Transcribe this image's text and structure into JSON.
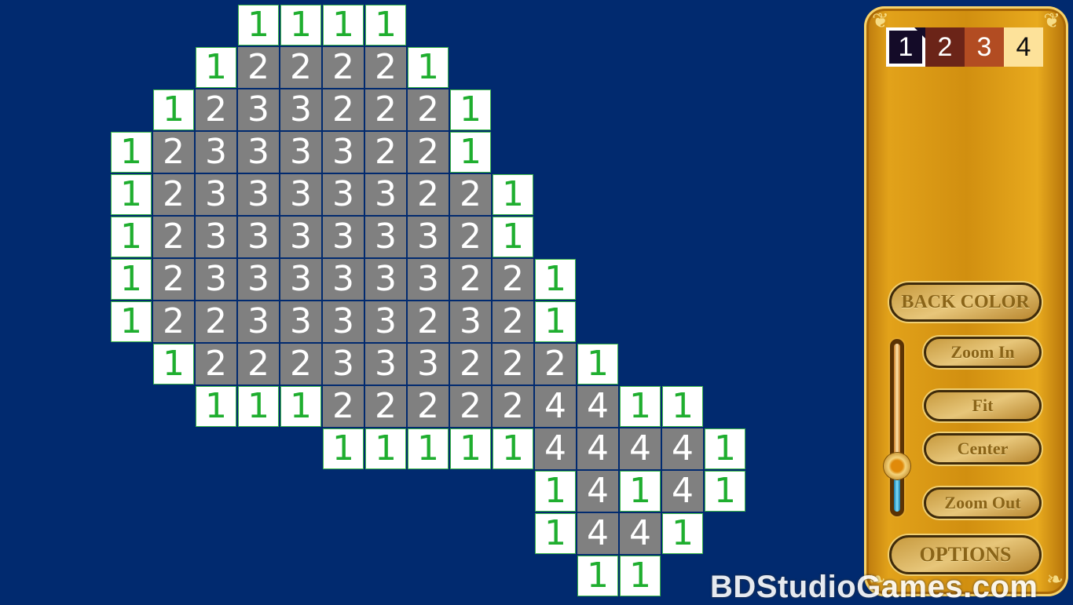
{
  "board": {
    "rows": [
      "...1111........",
      "..122221.......",
      ".12332221......",
      "123333221......",
      "1233333221.....",
      "1233333321.....",
      "12333333221....",
      "12233332321....",
      ".12223332221...",
      "..111222224411.",
      ".....1111144441",
      "..........14141",
      "..........1441.",
      "...........11.."
    ],
    "colors": {
      "background": "#012a6f",
      "revealed": "#808080",
      "unrevealed": "#ffffff",
      "number_one": "#1fae2f"
    }
  },
  "palette": [
    {
      "label": "1",
      "color": "#140b28",
      "text": "#ffffff",
      "selected": true
    },
    {
      "label": "2",
      "color": "#6b2418",
      "text": "#ffffff",
      "selected": false
    },
    {
      "label": "3",
      "color": "#b24c22",
      "text": "#ffffff",
      "selected": false
    },
    {
      "label": "4",
      "color": "#fde29a",
      "text": "#111111",
      "selected": false
    }
  ],
  "buttons": {
    "back_color": "BACK COLOR",
    "zoom_in": "Zoom In",
    "fit": "Fit",
    "center": "Center",
    "zoom_out": "Zoom Out",
    "options": "OPTIONS"
  },
  "zoom_slider": {
    "value": 0.27
  },
  "watermark": "BDStudioGames.com"
}
